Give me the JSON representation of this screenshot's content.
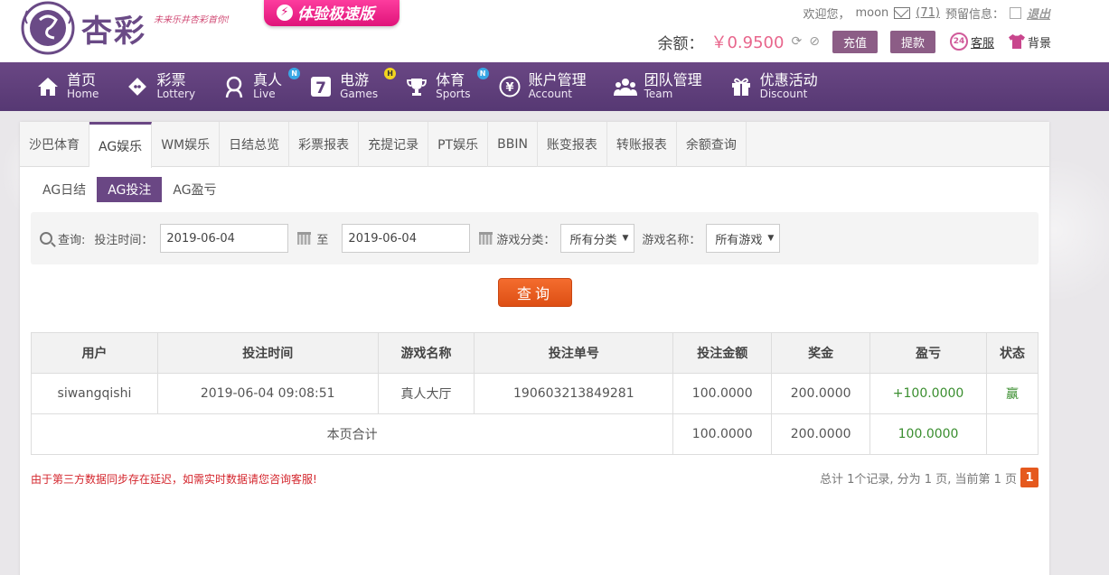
{
  "header": {
    "logo_text": "杏彩",
    "logo_slogan": "未来乐井杏彩首你!",
    "speed_badge": "体验极速版",
    "welcome": "欢迎您，",
    "username": "moon",
    "mail_count": "(71)",
    "reserved_info": "预留信息：",
    "logout": "退出",
    "balance_label": "余额：",
    "balance_value": "￥0.9500",
    "deposit": "充值",
    "withdraw": "提款",
    "service": "客服",
    "background": "背景",
    "cs_badge": "24"
  },
  "nav": {
    "items": [
      {
        "cn": "首页",
        "en": "Home",
        "icon": "home-icon"
      },
      {
        "cn": "彩票",
        "en": "Lottery",
        "icon": "lottery-icon"
      },
      {
        "cn": "真人",
        "en": "Live",
        "icon": "live-icon",
        "badge": "N"
      },
      {
        "cn": "电游",
        "en": "Games",
        "icon": "games-icon",
        "badge": "H"
      },
      {
        "cn": "体育",
        "en": "Sports",
        "icon": "trophy-icon",
        "badge": "N"
      },
      {
        "cn": "账户管理",
        "en": "Account",
        "icon": "yen-icon"
      },
      {
        "cn": "团队管理",
        "en": "Team",
        "icon": "team-icon"
      },
      {
        "cn": "优惠活动",
        "en": "Discount",
        "icon": "gift-icon"
      }
    ]
  },
  "tabs": [
    "沙巴体育",
    "AG娱乐",
    "WM娱乐",
    "日结总览",
    "彩票报表",
    "充提记录",
    "PT娱乐",
    "BBIN",
    "账变报表",
    "转账报表",
    "余额查询"
  ],
  "subtabs": [
    "AG日结",
    "AG投注",
    "AG盈亏"
  ],
  "filter": {
    "query_label": "查询:",
    "time_label": "投注时间：",
    "date_from": "2019-06-04",
    "to": "至",
    "date_to": "2019-06-04",
    "category_label": "游戏分类：",
    "category_value": "所有分类",
    "name_label": "游戏名称：",
    "name_value": "所有游戏",
    "query_button": "查询"
  },
  "table": {
    "headers": [
      "用户",
      "投注时间",
      "游戏名称",
      "投注单号",
      "投注金额",
      "奖金",
      "盈亏",
      "状态"
    ],
    "rows": [
      [
        "siwangqishi",
        "2019-06-04 09:08:51",
        "真人大厅",
        "190603213849281",
        "100.0000",
        "200.0000",
        "+100.0000",
        "赢"
      ]
    ],
    "total_label": "本页合计",
    "total_bet": "100.0000",
    "total_bonus": "200.0000",
    "total_profit": "100.0000"
  },
  "notice": "由于第三方数据同步存在延迟，如需实时数据请您咨询客服!",
  "pager": {
    "text": "总计 1个记录, 分为 1 页, 当前第 1 页",
    "current": "1"
  }
}
